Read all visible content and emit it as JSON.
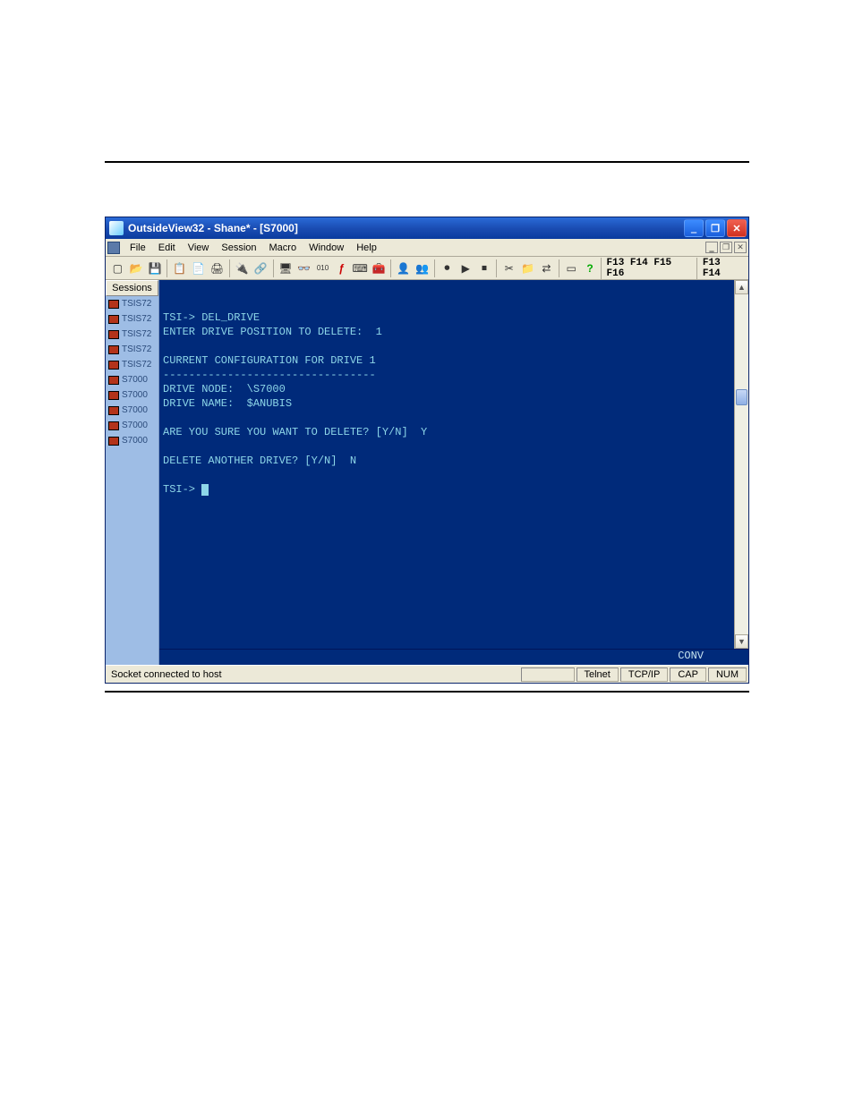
{
  "window": {
    "title": "OutsideView32 - Shane* - [S7000]"
  },
  "menus": [
    "File",
    "Edit",
    "View",
    "Session",
    "Macro",
    "Window",
    "Help"
  ],
  "fkeys": {
    "group1": "F13 F14 F15 F16",
    "group2": "F13 F14"
  },
  "sessions": {
    "header": "Sessions",
    "items": [
      {
        "label": "TSIS72"
      },
      {
        "label": "TSIS72"
      },
      {
        "label": "TSIS72"
      },
      {
        "label": "TSIS72"
      },
      {
        "label": "TSIS72"
      },
      {
        "label": "S7000"
      },
      {
        "label": "S7000"
      },
      {
        "label": "S7000"
      },
      {
        "label": "S7000"
      },
      {
        "label": "S7000"
      }
    ]
  },
  "terminal": {
    "lines": [
      "TSI-> DEL_DRIVE",
      "ENTER DRIVE POSITION TO DELETE:  1",
      "",
      "CURRENT CONFIGURATION FOR DRIVE 1",
      "---------------------------------",
      "DRIVE NODE:  \\S7000",
      "DRIVE NAME:  $ANUBIS",
      "",
      "ARE YOU SURE YOU WANT TO DELETE? [Y/N]  Y",
      "",
      "DELETE ANOTHER DRIVE? [Y/N]  N",
      "",
      "TSI-> "
    ],
    "status_right": "CONV"
  },
  "statusbar": {
    "message": "Socket connected to host",
    "panes": [
      "",
      "Telnet",
      "TCP/IP",
      "CAP",
      "NUM"
    ]
  }
}
